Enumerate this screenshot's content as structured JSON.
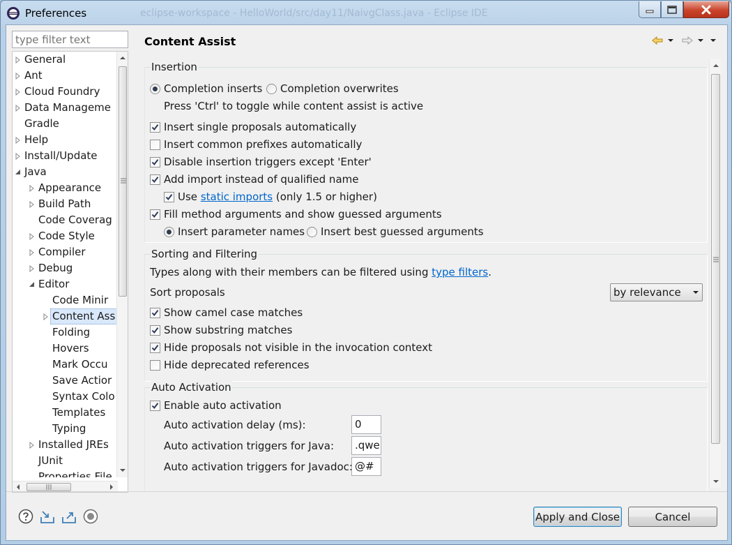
{
  "window": {
    "title": "Preferences",
    "background_title": "eclipse-workspace - HelloWorld/src/day11/NaivgClass.java - Eclipse IDE"
  },
  "filter": {
    "placeholder": "type filter text"
  },
  "tree": {
    "items": [
      {
        "label": "General",
        "level": 0,
        "twisty": "collapsed"
      },
      {
        "label": "Ant",
        "level": 0,
        "twisty": "collapsed"
      },
      {
        "label": "Cloud Foundry",
        "level": 0,
        "twisty": "collapsed"
      },
      {
        "label": "Data Manageme",
        "level": 0,
        "twisty": "collapsed"
      },
      {
        "label": "Gradle",
        "level": 0,
        "twisty": "none"
      },
      {
        "label": "Help",
        "level": 0,
        "twisty": "collapsed"
      },
      {
        "label": "Install/Update",
        "level": 0,
        "twisty": "collapsed"
      },
      {
        "label": "Java",
        "level": 0,
        "twisty": "expanded"
      },
      {
        "label": "Appearance",
        "level": 1,
        "twisty": "collapsed"
      },
      {
        "label": "Build Path",
        "level": 1,
        "twisty": "collapsed"
      },
      {
        "label": "Code Coverag",
        "level": 1,
        "twisty": "none"
      },
      {
        "label": "Code Style",
        "level": 1,
        "twisty": "collapsed"
      },
      {
        "label": "Compiler",
        "level": 1,
        "twisty": "collapsed"
      },
      {
        "label": "Debug",
        "level": 1,
        "twisty": "collapsed"
      },
      {
        "label": "Editor",
        "level": 1,
        "twisty": "expanded"
      },
      {
        "label": "Code Minir",
        "level": 2,
        "twisty": "none"
      },
      {
        "label": "Content Ass",
        "level": 2,
        "twisty": "collapsed",
        "selected": true
      },
      {
        "label": "Folding",
        "level": 2,
        "twisty": "none"
      },
      {
        "label": "Hovers",
        "level": 2,
        "twisty": "none"
      },
      {
        "label": "Mark Occu",
        "level": 2,
        "twisty": "none"
      },
      {
        "label": "Save Actior",
        "level": 2,
        "twisty": "none"
      },
      {
        "label": "Syntax Colo",
        "level": 2,
        "twisty": "none"
      },
      {
        "label": "Templates",
        "level": 2,
        "twisty": "none"
      },
      {
        "label": "Typing",
        "level": 2,
        "twisty": "none"
      },
      {
        "label": "Installed JREs",
        "level": 1,
        "twisty": "collapsed"
      },
      {
        "label": "JUnit",
        "level": 1,
        "twisty": "none"
      },
      {
        "label": "Properties File",
        "level": 1,
        "twisty": "none"
      }
    ]
  },
  "page": {
    "title": "Content Assist"
  },
  "insertion": {
    "title": "Insertion",
    "radio_inserts": "Completion inserts",
    "radio_overwrites": "Completion overwrites",
    "toggle_hint": "Press 'Ctrl' to toggle while content assist is active",
    "single_proposals": "Insert single proposals automatically",
    "common_prefixes": "Insert common prefixes automatically",
    "disable_triggers": "Disable insertion triggers except 'Enter'",
    "add_import": "Add import instead of qualified name",
    "use_prefix": "Use",
    "static_imports_link": "static imports",
    "use_suffix": "(only 1.5 or higher)",
    "fill_arguments": "Fill method arguments and show guessed arguments",
    "insert_param_names": "Insert parameter names",
    "insert_best_guessed": "Insert best guessed arguments"
  },
  "sorting": {
    "title": "Sorting and Filtering",
    "types_text": "Types along with their members can be filtered using",
    "type_filters_link": "type filters",
    "types_period": ".",
    "sort_label": "Sort proposals",
    "sort_value": "by relevance",
    "camel_case": "Show camel case matches",
    "substring": "Show substring matches",
    "hide_not_visible": "Hide proposals not visible in the invocation context",
    "hide_deprecated": "Hide deprecated references"
  },
  "auto_activation": {
    "title": "Auto Activation",
    "enable": "Enable auto activation",
    "delay_label": "Auto activation delay (ms):",
    "delay_value": "0",
    "java_label": "Auto activation triggers for Java:",
    "java_value": ".qwer",
    "javadoc_label": "Auto activation triggers for Javadoc:",
    "javadoc_value": "@#"
  },
  "states": {
    "completion_inserts": true,
    "single_proposals": true,
    "common_prefixes": false,
    "disable_triggers": true,
    "add_import": true,
    "use_static_imports": true,
    "fill_arguments": true,
    "insert_param_names": true,
    "camel_case": true,
    "substring": true,
    "hide_not_visible": true,
    "hide_deprecated": false,
    "enable_auto_activation": true
  },
  "buttons": {
    "apply_close": "Apply and Close",
    "cancel": "Cancel"
  },
  "bottom_icons": [
    "help-icon",
    "import-icon",
    "export-icon",
    "record-icon"
  ]
}
